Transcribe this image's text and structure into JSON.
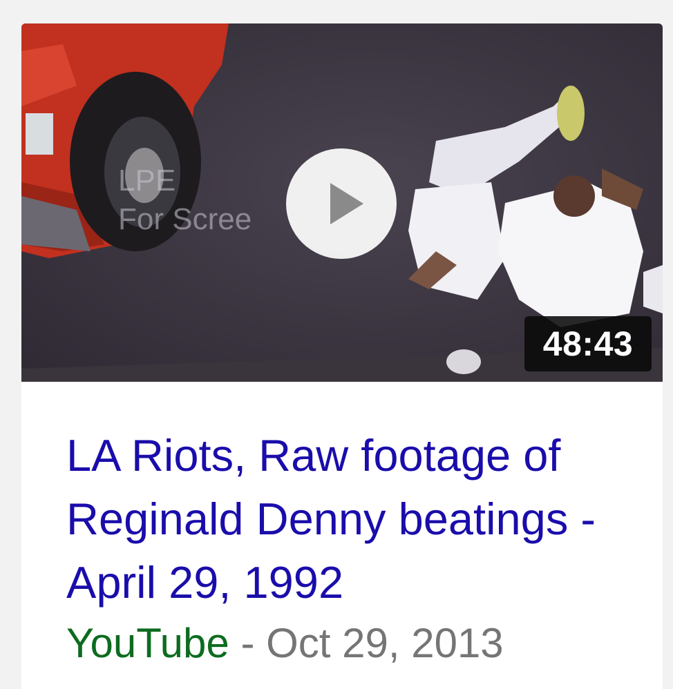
{
  "video": {
    "duration": "48:43",
    "watermark": "LPE\nFor Scree",
    "title": "LA Riots, Raw footage of Reginald Denny beatings - April 29, 1992",
    "source": "YouTube",
    "separator": " - ",
    "date": "Oct 29, 2013",
    "play_icon": "play-icon"
  },
  "colors": {
    "title_link": "#1a0dab",
    "source": "#0d6b1f",
    "date": "#757575"
  }
}
